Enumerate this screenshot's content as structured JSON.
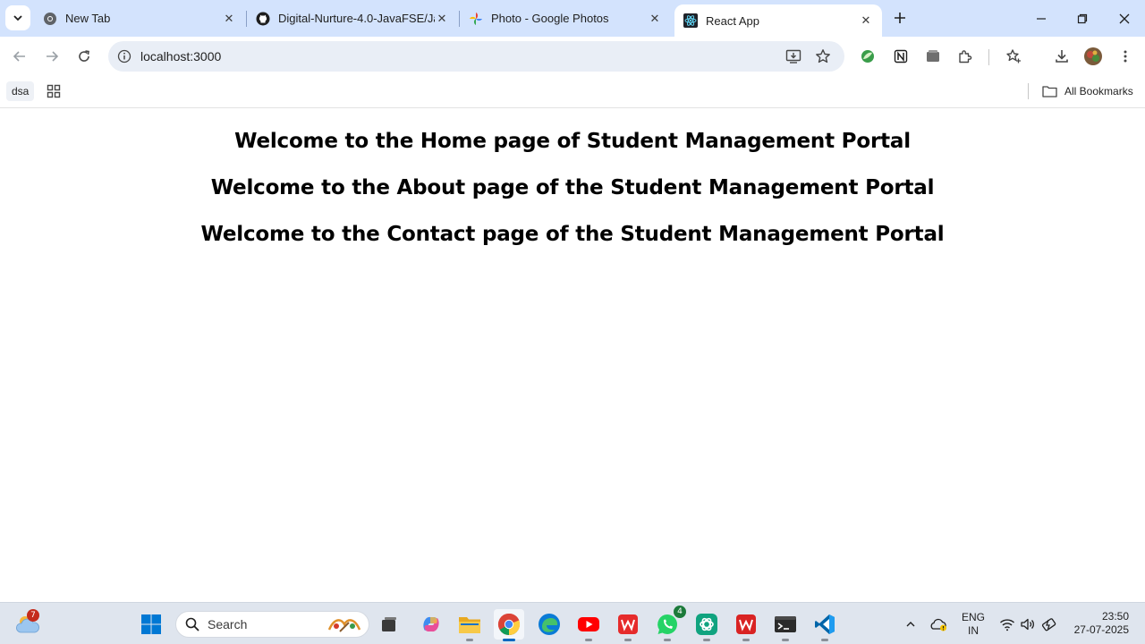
{
  "browser": {
    "tabs": [
      {
        "title": "New Tab",
        "icon": "chrome-icon"
      },
      {
        "title": "Digital-Nurture-4.0-JavaFSE/Jav",
        "icon": "github-icon"
      },
      {
        "title": "Photo - Google Photos",
        "icon": "google-photos-icon"
      },
      {
        "title": "React App",
        "icon": "react-icon",
        "active": true
      }
    ],
    "address": "localhost:3000",
    "bookmarks": {
      "items": [
        {
          "label": "dsa"
        }
      ],
      "all_label": "All Bookmarks"
    }
  },
  "page": {
    "headings": [
      "Welcome to the Home page of Student Management Portal",
      "Welcome to the About page of the Student Management Portal",
      "Welcome to the Contact page of the Student Management Portal"
    ]
  },
  "taskbar": {
    "weather_badge": "7",
    "search_placeholder": "Search",
    "whatsapp_badge": "4",
    "language": {
      "line1": "ENG",
      "line2": "IN"
    },
    "time": "23:50",
    "date": "27-07-2025"
  },
  "colors": {
    "tabstrip": "#d3e3fd",
    "omnibox": "#e9eef6",
    "taskbar": "#dfe5ee",
    "accent": "#0067c0"
  }
}
